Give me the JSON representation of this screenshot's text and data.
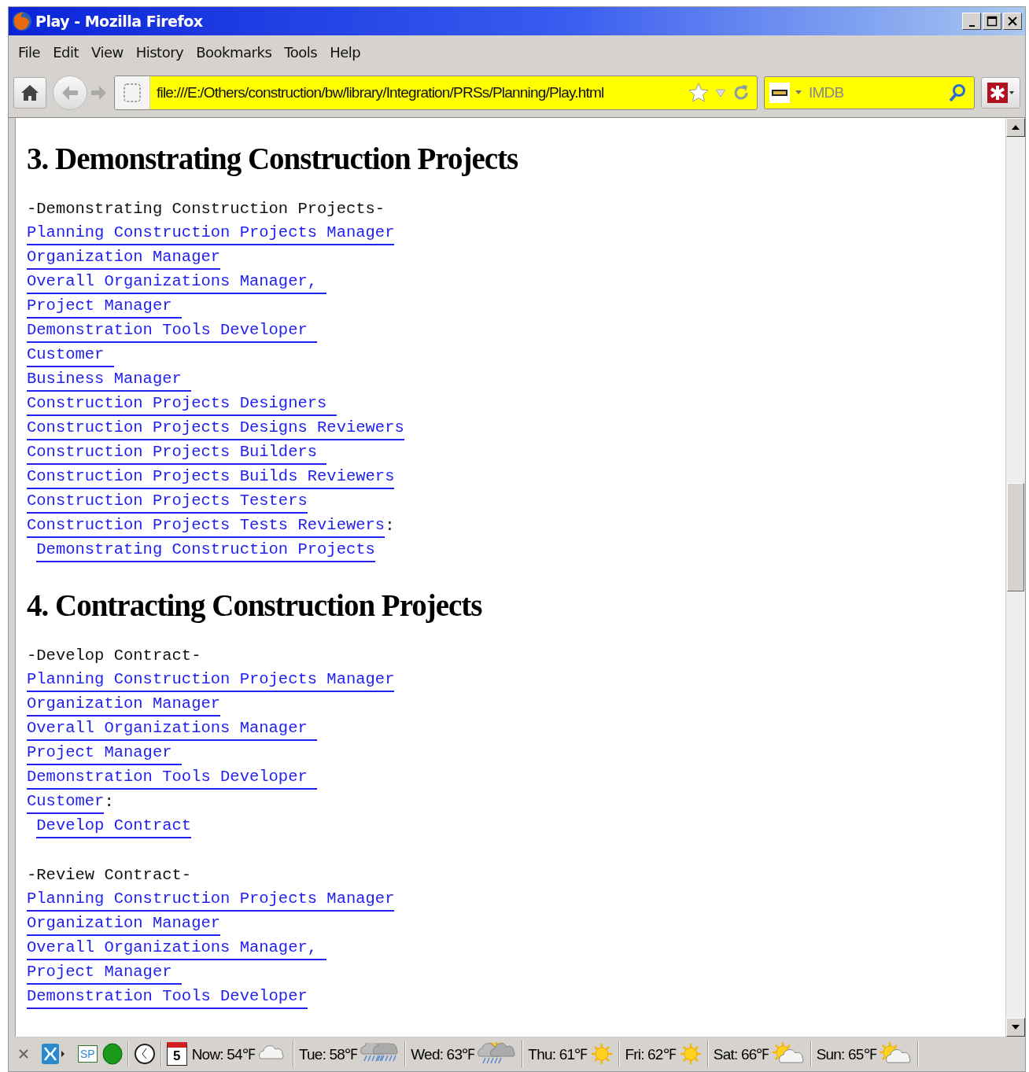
{
  "window": {
    "title": "Play - Mozilla Firefox"
  },
  "menu": [
    "File",
    "Edit",
    "View",
    "History",
    "Bookmarks",
    "Tools",
    "Help"
  ],
  "address_bar": {
    "value": "file:///E:/Others/construction/bw/library/Integration/PRSs/Planning/Play.html"
  },
  "search_bar": {
    "placeholder": "IMDB"
  },
  "sections": [
    {
      "heading": "3. Demonstrating Construction Projects",
      "blocks": [
        {
          "title": "-Demonstrating Construction Projects-",
          "links": [
            "Planning Construction Projects Manager",
            "Organization Manager",
            "Overall Organizations Manager, ",
            "Project Manager ",
            "Demonstration Tools Developer ",
            "Customer ",
            "Business Manager ",
            "Construction Projects Designers ",
            "Construction Projects Designs Reviewers",
            "Construction Projects Builders ",
            "Construction Projects Builds Reviewers",
            "Construction Projects Testers",
            "Construction Projects Tests Reviewers"
          ],
          "separator": ":",
          "action": "Demonstrating Construction Projects"
        }
      ]
    },
    {
      "heading": "4. Contracting Construction Projects",
      "blocks": [
        {
          "title": "-Develop Contract-",
          "links": [
            "Planning Construction Projects Manager",
            "Organization Manager",
            "Overall Organizations Manager ",
            "Project Manager ",
            "Demonstration Tools Developer ",
            "Customer"
          ],
          "separator": ":",
          "action": "Develop Contract"
        },
        {
          "title": "-Review Contract-",
          "links": [
            "Planning Construction Projects Manager",
            "Organization Manager",
            "Overall Organizations Manager, ",
            "Project Manager ",
            "Demonstration Tools Developer"
          ]
        }
      ]
    }
  ],
  "status_bar": {
    "sp_label": "SP",
    "calendar_day": "5",
    "weather": [
      {
        "label": "Now: 54℉",
        "kind": "cloudy"
      },
      {
        "label": "Tue: 58℉",
        "kind": "rain"
      },
      {
        "label": "Wed: 63℉",
        "kind": "sun-rain"
      },
      {
        "label": "Thu: 61℉",
        "kind": "sunny"
      },
      {
        "label": "Fri: 62℉",
        "kind": "sunny"
      },
      {
        "label": "Sat: 66℉",
        "kind": "sun-cloud"
      },
      {
        "label": "Sun: 65℉",
        "kind": "sun-cloud"
      }
    ]
  }
}
